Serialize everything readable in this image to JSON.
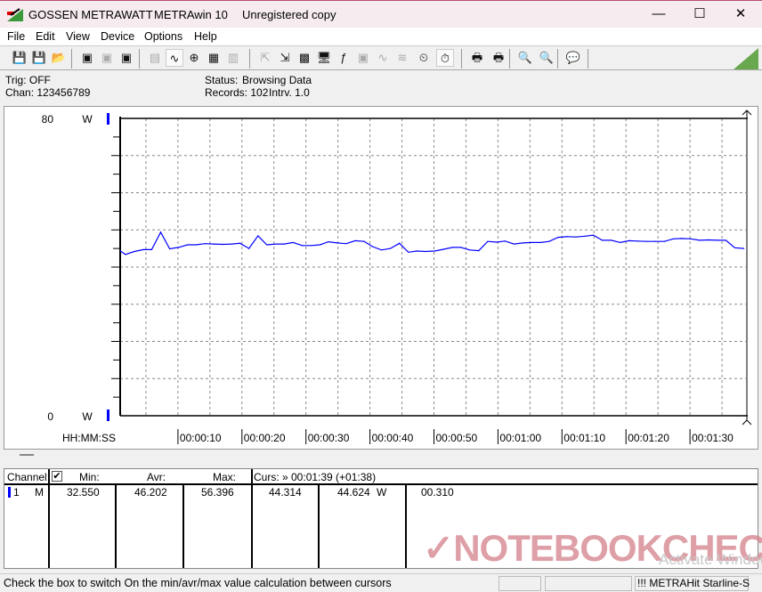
{
  "window": {
    "title_brand": "GOSSEN METRAWATT",
    "app_name": "METRAwin 10",
    "license": "Unregistered copy",
    "minimize": "—",
    "maximize": "☐",
    "close": "✕"
  },
  "menu": [
    {
      "label": "File"
    },
    {
      "label": "Edit"
    },
    {
      "label": "View"
    },
    {
      "label": "Device"
    },
    {
      "label": "Options"
    },
    {
      "label": "Help"
    }
  ],
  "toolbar": [
    {
      "icon": "save-icon",
      "glyph": "💾"
    },
    {
      "icon": "save-as-icon",
      "glyph": "💾"
    },
    {
      "icon": "open-folder-icon",
      "glyph": "📂"
    },
    {
      "icon": "device-read-icon",
      "glyph": "▣"
    },
    {
      "icon": "device-transfer-icon",
      "glyph": "▣",
      "disabled": true
    },
    {
      "icon": "device-memory-icon",
      "glyph": "▣"
    },
    {
      "icon": "numeric-display-icon",
      "glyph": "▤",
      "disabled": true
    },
    {
      "icon": "graph-view-icon",
      "glyph": "∿",
      "active": true
    },
    {
      "icon": "xy-crosshair-icon",
      "glyph": "⊕"
    },
    {
      "icon": "table-view-icon",
      "glyph": "▦"
    },
    {
      "icon": "bar-graph-icon",
      "glyph": "▥",
      "disabled": true
    },
    {
      "icon": "export-icon",
      "glyph": "⇱",
      "disabled": true
    },
    {
      "icon": "import-icon",
      "glyph": "⇲"
    },
    {
      "icon": "channel-config-icon",
      "glyph": "▩"
    },
    {
      "icon": "monitor-icon",
      "glyph": "🖥"
    },
    {
      "icon": "function-icon",
      "glyph": "ƒ"
    },
    {
      "icon": "device-disabled-icon",
      "glyph": "▣",
      "disabled": true
    },
    {
      "icon": "trigger-wave-icon",
      "glyph": "∿",
      "disabled": true
    },
    {
      "icon": "sample-wave-icon",
      "glyph": "≋",
      "disabled": true
    },
    {
      "icon": "timer-icon",
      "glyph": "⏲"
    },
    {
      "icon": "stopwatch-icon",
      "glyph": "⏱",
      "active": true
    },
    {
      "icon": "print-icon",
      "glyph": "🖶"
    },
    {
      "icon": "print-preview-icon",
      "glyph": "🖶"
    },
    {
      "icon": "zoom-wave-icon",
      "glyph": "🔍"
    },
    {
      "icon": "zoom-curve-icon",
      "glyph": "🔍"
    },
    {
      "icon": "comment-icon",
      "glyph": "💬"
    }
  ],
  "info": {
    "trig": "Trig: OFF",
    "chan": "Chan:  123456789",
    "status_label": "Status:",
    "status_value": "Browsing Data",
    "records": "Records: 102",
    "interval": "Intrv. 1.0"
  },
  "chart_data": {
    "type": "line",
    "ylim": [
      0,
      80
    ],
    "y_top_label": "80",
    "y_bottom_label": "0",
    "y_unit": "W",
    "xlabel": "HH:MM:SS",
    "x_unit": "seconds",
    "xlim": [
      1,
      99
    ],
    "x_ticks": [
      "00:00:10",
      "00:00:20",
      "00:00:30",
      "00:00:40",
      "00:00:50",
      "00:01:00",
      "00:01:10",
      "00:01:20",
      "00:01:30"
    ],
    "x_tick_values": [
      10,
      20,
      30,
      40,
      50,
      60,
      70,
      80,
      90
    ],
    "grid": true,
    "series_color": "#0000ff",
    "x": [
      1.0,
      1.8,
      3.2,
      4.6,
      5.9,
      7.3,
      8.7,
      10.1,
      11.5,
      12.8,
      14.2,
      15.6,
      17.0,
      18.4,
      19.7,
      21.1,
      22.5,
      23.9,
      25.3,
      26.6,
      28.0,
      29.4,
      30.8,
      32.2,
      33.5,
      34.9,
      36.3,
      37.7,
      39.1,
      40.4,
      41.8,
      43.2,
      44.6,
      46.0,
      47.3,
      48.7,
      50.1,
      51.5,
      52.9,
      54.2,
      55.6,
      57.0,
      58.4,
      59.8,
      61.1,
      62.5,
      63.9,
      65.3,
      66.7,
      68.0,
      69.4,
      70.8,
      72.2,
      73.6,
      74.9,
      76.3,
      77.7,
      79.1,
      80.5,
      81.8,
      83.2,
      84.6,
      86.0,
      87.4,
      88.7,
      90.1,
      91.5,
      92.9,
      94.3,
      95.6,
      97.0,
      98.4
    ],
    "values": [
      44.3,
      43.4,
      44.2,
      44.7,
      44.7,
      49.4,
      44.9,
      45.3,
      46.0,
      46.0,
      46.3,
      46.2,
      46.1,
      46.2,
      46.4,
      45.0,
      48.4,
      46.0,
      46.2,
      46.2,
      46.6,
      45.8,
      45.8,
      46.0,
      46.8,
      46.5,
      46.3,
      47.1,
      46.9,
      45.5,
      44.6,
      45.0,
      46.4,
      44.0,
      44.3,
      44.2,
      44.3,
      44.8,
      45.3,
      45.3,
      44.6,
      44.4,
      46.9,
      46.7,
      47.0,
      46.2,
      46.5,
      46.6,
      46.6,
      46.9,
      48.0,
      48.2,
      48.1,
      48.3,
      48.6,
      47.2,
      47.2,
      46.6,
      47.1,
      47.0,
      46.9,
      46.9,
      46.9,
      47.6,
      47.7,
      47.6,
      47.2,
      47.3,
      47.2,
      47.2,
      45.2,
      45.0
    ]
  },
  "table": {
    "headers": {
      "channel": "Channel:",
      "min": "Min:",
      "avr": "Avr:",
      "max": "Max:",
      "cursor": "Curs: » 00:01:39 (+01:38)"
    },
    "checkbox_checked": true,
    "rows": [
      {
        "channel": "1",
        "mode": "M",
        "min": "32.550",
        "avr": "46.202",
        "max": "56.396",
        "cursor1": "44.314",
        "cursor2": "44.624",
        "unit": "W",
        "delta": "00.310"
      }
    ]
  },
  "watermark": {
    "logo": "NOTEBOOKCHECK",
    "activate_line1": "Activate Windows",
    "activate_line2": "Go to Settings to activate Windows."
  },
  "statusbar": {
    "hint": "Check the box to switch On the min/avr/max value calculation between cursors",
    "device": "!!! METRAHit Starline-S"
  }
}
